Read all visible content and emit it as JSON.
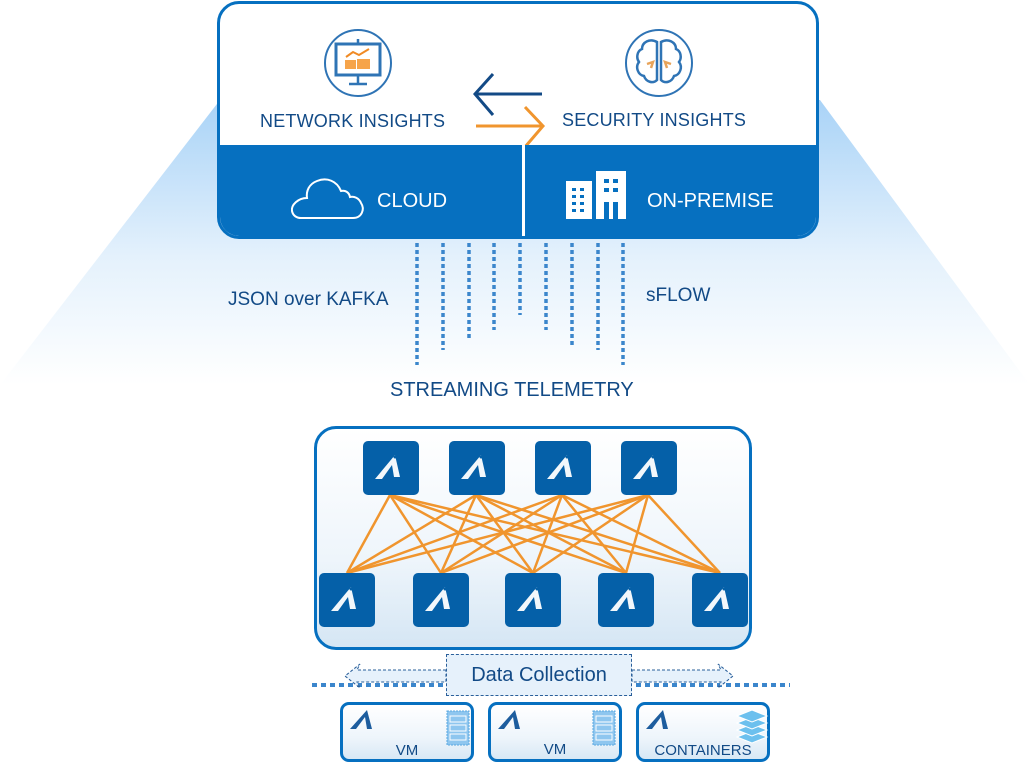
{
  "colors": {
    "primary_blue": "#0670c0",
    "dark_text": "#124a86",
    "accent_orange": "#f0952e",
    "switch_blue": "#0560a8",
    "navy_arrow": "#134a86"
  },
  "top_panel": {
    "network_insights": {
      "label": "NETWORK  INSIGHTS",
      "icon": "monitor-chart-icon"
    },
    "security_insights": {
      "label": "SECURITY INSIGHTS",
      "icon": "brain-icon"
    },
    "exchange_arrows": {
      "left_arrow": "arrow-left-icon",
      "right_arrow": "arrow-right-icon"
    },
    "cloud": {
      "label": "CLOUD",
      "icon": "cloud-icon"
    },
    "on_premise": {
      "label": "ON-PREMISE",
      "icon": "buildings-icon"
    }
  },
  "telemetry": {
    "left_protocol": "JSON over KAFKA",
    "right_protocol": "sFLOW",
    "caption": "STREAMING TELEMETRY",
    "stream_count": 9
  },
  "fabric": {
    "spine_count": 4,
    "leaf_count": 5,
    "switch_icon": "arista-logo-icon",
    "topology": "full-mesh spine-leaf"
  },
  "data_collection": {
    "label": "Data Collection"
  },
  "hosts": [
    {
      "label": "VM",
      "icon": "server-icon"
    },
    {
      "label": "VM",
      "icon": "server-icon"
    },
    {
      "label": "CONTAINERS",
      "icon": "layers-icon"
    }
  ]
}
